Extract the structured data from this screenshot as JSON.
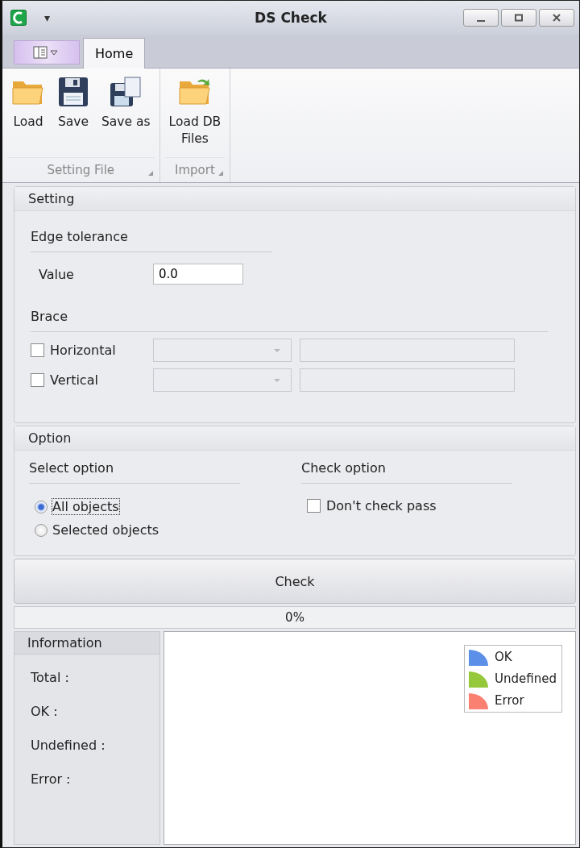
{
  "window": {
    "title": "DS Check",
    "quick_access_caret": "▾"
  },
  "ribbon": {
    "tabs": [
      {
        "label": "Home",
        "selected": true
      }
    ],
    "groups": [
      {
        "label": "Setting File",
        "buttons": [
          {
            "label": "Load",
            "kind": "folder"
          },
          {
            "label": "Save",
            "kind": "disk"
          },
          {
            "label": "Save as",
            "kind": "disk-copy"
          }
        ]
      },
      {
        "label": "Import",
        "buttons": [
          {
            "label": "Load DB\nFiles",
            "kind": "folder-arrow"
          }
        ]
      }
    ]
  },
  "setting": {
    "title": "Setting",
    "edge_tolerance": {
      "title": "Edge tolerance",
      "label": "Value",
      "value": "0.0"
    },
    "brace": {
      "title": "Brace",
      "rows": [
        {
          "label": "Horizontal",
          "checked": false
        },
        {
          "label": "Vertical",
          "checked": false
        }
      ]
    }
  },
  "option": {
    "title": "Option",
    "select": {
      "title": "Select option",
      "options": [
        {
          "label": "All objects",
          "selected": true
        },
        {
          "label": "Selected objects",
          "selected": false
        }
      ]
    },
    "check": {
      "title": "Check option",
      "items": [
        {
          "label": "Don't check pass",
          "checked": false
        }
      ]
    }
  },
  "check_button": "Check",
  "progress": {
    "reading": "0%"
  },
  "information": {
    "title": "Information",
    "rows": [
      "Total :",
      "OK :",
      "Undefined :",
      "Error :"
    ]
  },
  "legend": [
    {
      "label": "OK",
      "color": "#5b8fe8"
    },
    {
      "label": "Undefined",
      "color": "#95c83a"
    },
    {
      "label": "Error",
      "color": "#fa8072"
    }
  ]
}
